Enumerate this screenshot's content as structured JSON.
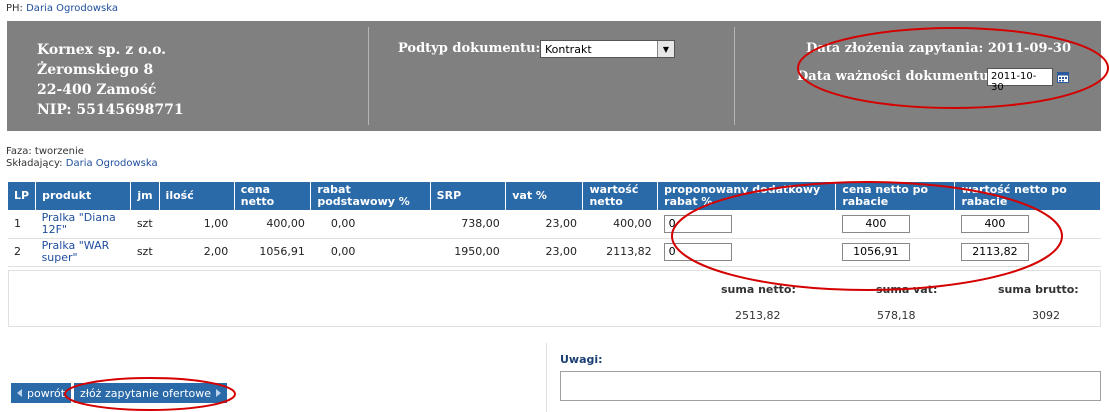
{
  "ph": {
    "label": "PH:",
    "name": "Daria Ogrodowska"
  },
  "company": {
    "name": "Kornex sp. z o.o.",
    "street": "Żeromskiego 8",
    "city": "22-400 Zamość",
    "nip": "NIP: 55145698771"
  },
  "subtype": {
    "label": "Podtyp dokumentu:",
    "value": "Kontrakt"
  },
  "dates": {
    "request_label": "Data złożenia zapytania:",
    "request_value": "2011-09-30",
    "validity_label": "Data ważności dokumentu:",
    "validity_value": "2011-10-30"
  },
  "info": {
    "phase_label": "Faza:",
    "phase_value": "tworzenie",
    "submitter_label": "Składający:",
    "submitter_value": "Daria Ogrodowska"
  },
  "table": {
    "headers": [
      "LP",
      "produkt",
      "jm",
      "ilość",
      "cena netto",
      "rabat podstawowy %",
      "SRP",
      "vat %",
      "wartość netto",
      "proponowany dodatkowy rabat %",
      "cena netto po rabacie",
      "wartość netto po rabacie"
    ],
    "rows": [
      {
        "lp": "1",
        "produkt": "Pralka \"Diana 12F\"",
        "jm": "szt",
        "ilosc": "1,00",
        "cena_netto": "400,00",
        "rabat": "0,00",
        "srp": "738,00",
        "vat": "23,00",
        "wartosc_netto": "400,00",
        "rabat_dod": "0",
        "cena_po": "400",
        "wartosc_po": "400"
      },
      {
        "lp": "2",
        "produkt": "Pralka \"WAR super\"",
        "jm": "szt",
        "ilosc": "2,00",
        "cena_netto": "1056,91",
        "rabat": "0,00",
        "srp": "1950,00",
        "vat": "23,00",
        "wartosc_netto": "2113,82",
        "rabat_dod": "0",
        "cena_po": "1056,91",
        "wartosc_po": "2113,82"
      }
    ]
  },
  "summary": {
    "netto_label": "suma netto:",
    "netto_value": "2513,82",
    "vat_label": "suma vat:",
    "vat_value": "578,18",
    "brutto_label": "suma brutto:",
    "brutto_value": "3092"
  },
  "remarks": {
    "label": "Uwagi:",
    "value": ""
  },
  "buttons": {
    "back": "powrót",
    "submit": "złóż zapytanie ofertowe"
  },
  "colors": {
    "header_bg": "#808080",
    "table_header": "#2a6aa8",
    "annotation": "#d40000"
  }
}
